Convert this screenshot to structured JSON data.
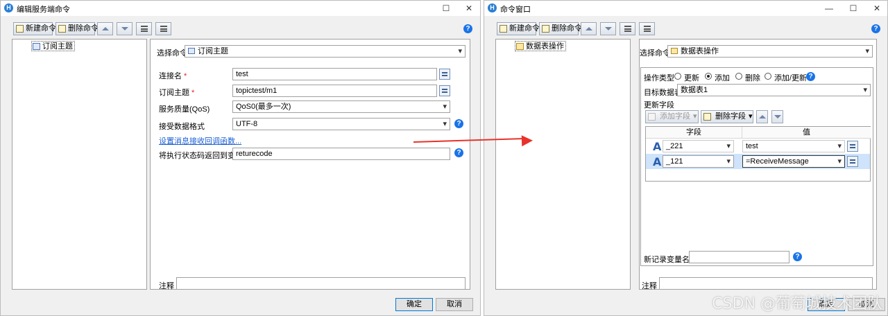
{
  "win1": {
    "title": "编辑服务端命令",
    "toolbar": {
      "new_cmd": "新建命令",
      "del_cmd": "删除命令"
    },
    "tree": {
      "item": "订阅主题"
    },
    "select_cmd_label": "选择命令:",
    "select_cmd_value": "订阅主题",
    "fields": {
      "conn_label": "连接名",
      "conn_value": "test",
      "topic_label": "订阅主题",
      "topic_value": "topictest/m1",
      "qos_label": "服务质量(QoS)",
      "qos_value": "QoS0(最多一次)",
      "format_label": "接受数据格式",
      "format_value": "UTF-8",
      "callback_link": "设置消息接收回调函数...",
      "retvar_label": "将执行状态码返回到变量",
      "retvar_value": "returecode"
    },
    "note_label": "注释",
    "note_value": "",
    "ok": "确定",
    "cancel": "取消"
  },
  "win2": {
    "title": "命令窗口",
    "toolbar": {
      "new_cmd": "新建命令",
      "del_cmd": "删除命令"
    },
    "tree": {
      "item": "数据表操作"
    },
    "select_cmd_label": "选择命令:",
    "select_cmd_value": "数据表操作",
    "op_type_label": "操作类型",
    "radios": [
      "更新",
      "添加",
      "删除",
      "添加/更新"
    ],
    "radio_selected": "添加",
    "target_label": "目标数据表",
    "target_value": "数据表1",
    "update_fields_label": "更新字段",
    "add_field": "添加字段",
    "del_field": "删除字段",
    "grid": {
      "col_field": "字段",
      "col_value": "值",
      "rows": [
        {
          "field": "_221",
          "value": "test"
        },
        {
          "field": "_121",
          "value": "=ReceiveMessage"
        }
      ]
    },
    "new_record_label": "新记录变量名:",
    "new_record_value": "",
    "note_label": "注释",
    "note_value": "",
    "ok": "确定",
    "cancel": "取消"
  },
  "watermark": "CSDN @葡萄城技术团队",
  "colors": {
    "accent": "#1a73e8",
    "arrow": "#e8322a",
    "link": "#1a5fd4"
  }
}
